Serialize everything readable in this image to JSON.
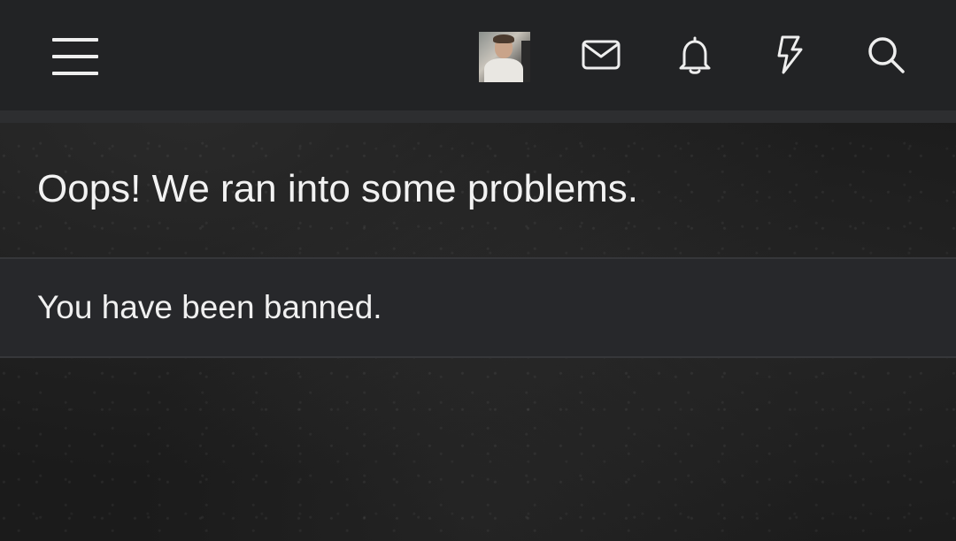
{
  "header": {
    "icons": {
      "menu": "hamburger-menu-icon",
      "avatar": "user-avatar",
      "messages": "envelope-icon",
      "notifications": "bell-icon",
      "activity": "lightning-bolt-icon",
      "search": "search-icon"
    }
  },
  "error": {
    "title": "Oops! We ran into some problems.",
    "message": "You have been banned."
  },
  "colors": {
    "topbar": "#222325",
    "notice_bg": "#27282b",
    "text": "#f2f2f2"
  }
}
